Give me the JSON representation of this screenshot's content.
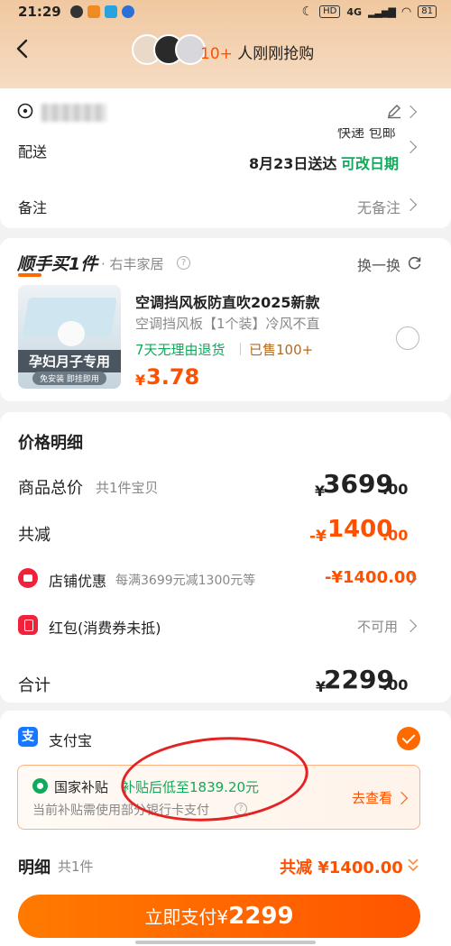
{
  "status_bar": {
    "time": "21:29",
    "hd": "HD",
    "network": "4G",
    "battery": "81"
  },
  "header": {
    "count": "10+",
    "buying_text": "人刚刚抢购"
  },
  "delivery": {
    "label": "配送",
    "method": "快递 包邮",
    "date": "8月23日送达",
    "change_date": "可改日期"
  },
  "remark": {
    "label": "备注",
    "value": "无备注"
  },
  "shunshou": {
    "title": "顺手买1件",
    "shop": "· 右丰家居",
    "swap": "换一换",
    "product": {
      "title": "空调挡风板防直吹2025新款",
      "spec": "空调挡风板【1个装】冷风不直",
      "return_policy": "7天无理由退货",
      "sold": "已售100+",
      "price_symbol": "¥",
      "price": "3.78",
      "image_label": "孕妇月子专用",
      "image_sub": "免安装 即挂即用"
    }
  },
  "price_detail": {
    "title": "价格明细",
    "goods_total_label": "商品总价",
    "goods_total_count": "共1件宝贝",
    "goods_total_symbol": "¥",
    "goods_total_int": "3699",
    "goods_total_dec": ".00",
    "discount_label": "共减",
    "discount_prefix": "-¥",
    "discount_int": "1400",
    "discount_dec": ".00",
    "shop_coupon_label": "店铺优惠",
    "shop_coupon_desc": "每满3699元减1300元等",
    "shop_coupon_value": "-¥1400.00",
    "red_packet_label": "红包(消费券未抵)",
    "red_packet_value": "不可用",
    "total_label": "合计",
    "total_symbol": "¥",
    "total_int": "2299",
    "total_dec": ".00"
  },
  "payment": {
    "method": "支付宝",
    "alipay_glyph": "支",
    "subsidy_title": "国家补贴",
    "subsidy_text": "补贴后低至1839.20元",
    "subsidy_note": "当前补贴需使用部分银行卡支付",
    "go_see": "去查看",
    "detail_label": "明细",
    "detail_count": "共1件",
    "detail_discount": "共减 ¥1400.00",
    "pay_button_prefix": "立即支付¥",
    "pay_button_amount": "2299"
  },
  "colors": {
    "accent": "#ff5000",
    "green": "#11a95b",
    "alipay_blue": "#1677ff",
    "coupon_red": "#f0213a"
  }
}
